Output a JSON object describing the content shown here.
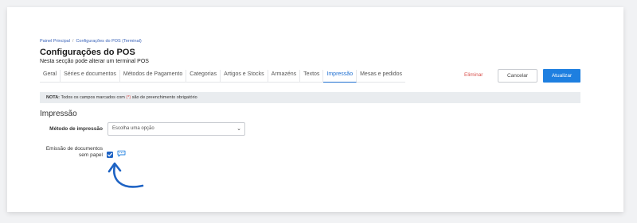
{
  "breadcrumb": {
    "item1": "Painel Principal",
    "separator": "/",
    "item2": "Configurações do POS (Terminal)"
  },
  "header": {
    "title": "Configurações do POS",
    "subtitle": "Nesta secção pode alterar um terminal POS"
  },
  "tabs": [
    {
      "label": "Geral"
    },
    {
      "label": "Séries e documentos"
    },
    {
      "label": "Métodos de Pagamento"
    },
    {
      "label": "Categorias"
    },
    {
      "label": "Artigos e Stocks"
    },
    {
      "label": "Armazéns"
    },
    {
      "label": "Textos"
    },
    {
      "label": "Impressão",
      "active": true
    },
    {
      "label": "Mesas e pedidos"
    }
  ],
  "actions": {
    "delete_label": "Eliminar",
    "cancel_label": "Cancelar",
    "update_label": "Atualizar"
  },
  "note": {
    "prefix": "NOTA:",
    "text_before": "Todos os campos marcados com",
    "required_mark": "(*)",
    "text_after": "são de preenchimento obrigatório"
  },
  "section": {
    "title": "Impressão",
    "print_method": {
      "label": "Método de impressão",
      "value": "Escolha uma opção"
    },
    "paperless": {
      "label_line1": "Emissão de documentos",
      "label_line2": "sem papel",
      "checked": true
    }
  },
  "colors": {
    "accent": "#1e7fe0",
    "danger": "#d9534f",
    "note_bg": "#e9ecef"
  },
  "icons": {
    "checkbox": "check-icon",
    "help": "chat-bubble-icon",
    "annotation": "curved-arrow-icon"
  }
}
